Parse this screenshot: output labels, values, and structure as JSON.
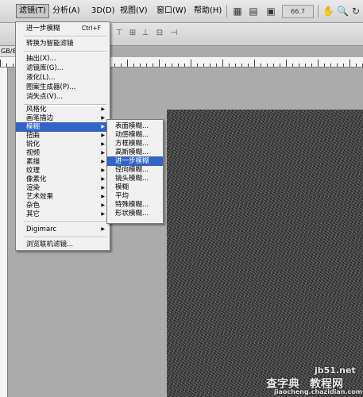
{
  "menubar": {
    "items": [
      {
        "label": "滤镜(T)",
        "active": true
      },
      {
        "label": "分析(A)"
      },
      {
        "label": "3D(D)"
      },
      {
        "label": "视图(V)"
      },
      {
        "label": "窗口(W)"
      },
      {
        "label": "帮助(H)"
      }
    ],
    "zoom": "66.7"
  },
  "doc_tab": "GB/8",
  "filter_menu": {
    "items": [
      {
        "label": "进一步模糊",
        "shortcut": "Ctrl+F"
      },
      {
        "label": "转换为智能滤镜"
      },
      {
        "label": "抽出(X)..."
      },
      {
        "label": "滤镜库(G)..."
      },
      {
        "label": "液化(L)..."
      },
      {
        "label": "图案生成器(P)..."
      },
      {
        "label": "消失点(V)..."
      },
      {
        "label": "风格化",
        "submenu": true
      },
      {
        "label": "画笔描边",
        "submenu": true
      },
      {
        "label": "模糊",
        "submenu": true,
        "highlighted": true
      },
      {
        "label": "扭曲",
        "submenu": true
      },
      {
        "label": "锐化",
        "submenu": true
      },
      {
        "label": "视频",
        "submenu": true
      },
      {
        "label": "素描",
        "submenu": true
      },
      {
        "label": "纹理",
        "submenu": true
      },
      {
        "label": "像素化",
        "submenu": true
      },
      {
        "label": "渲染",
        "submenu": true
      },
      {
        "label": "艺术效果",
        "submenu": true
      },
      {
        "label": "杂色",
        "submenu": true
      },
      {
        "label": "其它",
        "submenu": true
      },
      {
        "label": "Digimarc",
        "submenu": true
      },
      {
        "label": "浏览联机滤镜..."
      }
    ]
  },
  "blur_submenu": {
    "items": [
      {
        "label": "表面模糊..."
      },
      {
        "label": "动感模糊..."
      },
      {
        "label": "方框模糊..."
      },
      {
        "label": "高斯模糊..."
      },
      {
        "label": "进一步模糊",
        "highlighted": true
      },
      {
        "label": "径向模糊..."
      },
      {
        "label": "镜头模糊..."
      },
      {
        "label": "模糊"
      },
      {
        "label": "平均"
      },
      {
        "label": "特殊模糊..."
      },
      {
        "label": "形状模糊..."
      }
    ]
  },
  "watermark": {
    "site": "jb51.net",
    "text1": "查字典",
    "text2": "教程网",
    "url": "jiaocheng.chazidian.com"
  },
  "colors": {
    "highlight": "#3464c4",
    "menu_bg": "#f0f0f0",
    "workspace": "#ababab"
  }
}
